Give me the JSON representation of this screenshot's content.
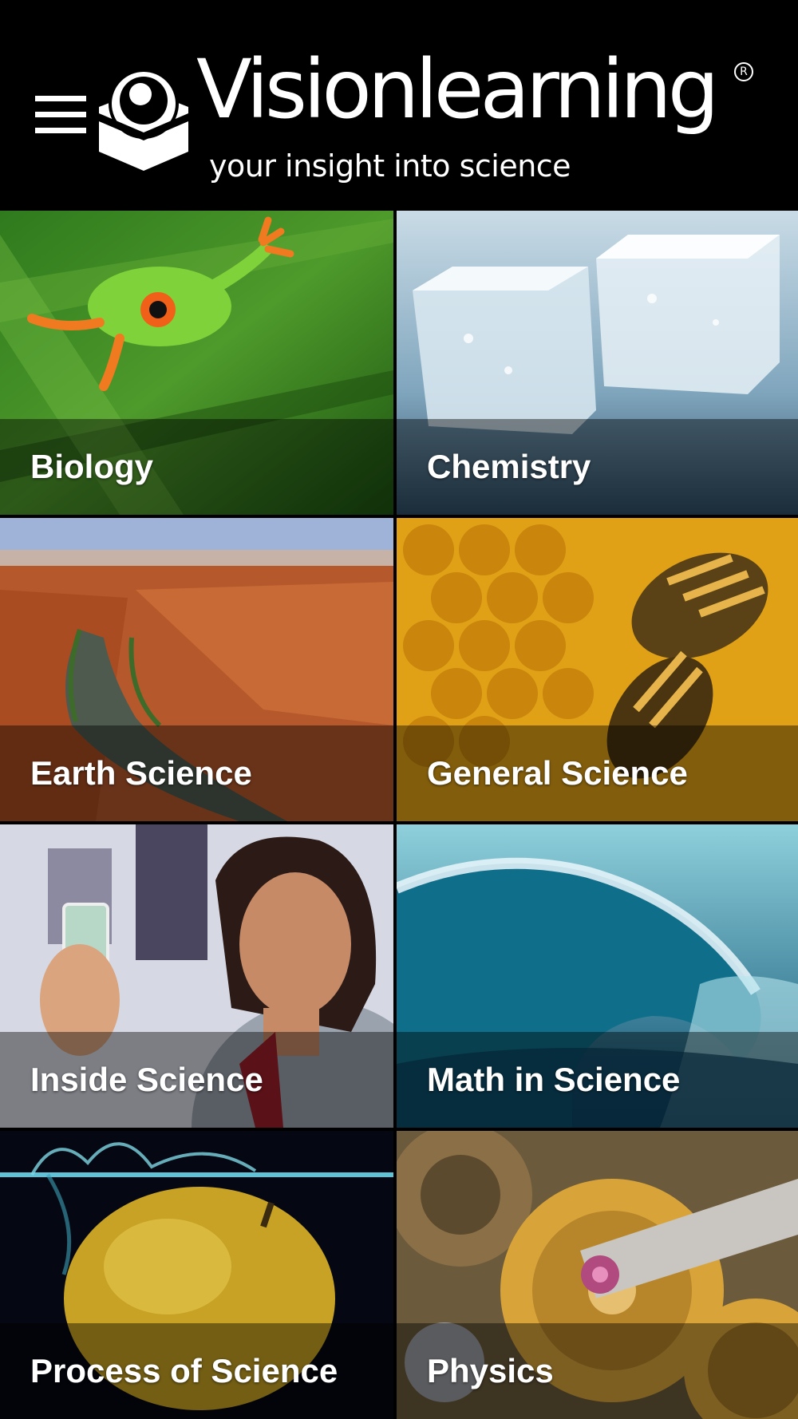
{
  "header": {
    "brand": "Visionlearning",
    "registered_mark": "R",
    "tagline": "your insight into science",
    "menu_icon": "hamburger-menu-icon",
    "logo_icon": "eye-box-logo-icon"
  },
  "colors": {
    "background": "#000000",
    "text": "#ffffff",
    "label_bar": "rgba(0,0,0,0.42)"
  },
  "tiles": [
    {
      "label": "Biology",
      "image": "tree-frog-on-leaf"
    },
    {
      "label": "Chemistry",
      "image": "ice-cubes-with-droplets"
    },
    {
      "label": "Earth Science",
      "image": "red-rock-canyon-river"
    },
    {
      "label": "General Science",
      "image": "bees-on-honeycomb"
    },
    {
      "label": "Inside Science",
      "image": "scientist-holding-sample"
    },
    {
      "label": "Math in Science",
      "image": "ocean-wave"
    },
    {
      "label": "Process of Science",
      "image": "apple-splashing-in-water"
    },
    {
      "label": "Physics",
      "image": "watch-gears"
    }
  ]
}
